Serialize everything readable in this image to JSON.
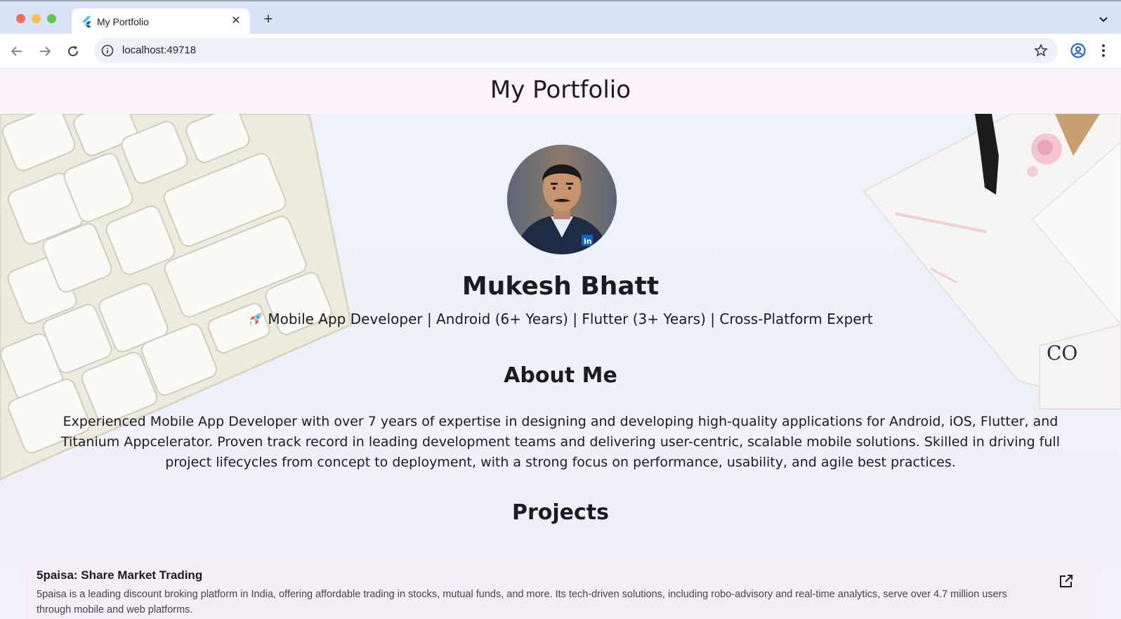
{
  "browser": {
    "tab_title": "My Portfolio",
    "tab_icon": "flutter-icon",
    "url": "localhost:49718",
    "close_icon": "close-icon",
    "new_tab_icon": "plus-icon"
  },
  "appbar": {
    "title": "My Portfolio"
  },
  "profile": {
    "name": "Mukesh Bhatt",
    "tagline": "Mobile App Developer | Android (6+ Years) | Flutter (3+ Years) | Cross-Platform Expert",
    "tagline_icon": "rocket-icon"
  },
  "about": {
    "title": "About Me",
    "text": "Experienced Mobile App Developer with over 7 years of expertise in designing and developing high-quality applications for Android, iOS, Flutter, and Titanium Appcelerator. Proven track record in leading development teams and delivering user-centric, scalable mobile solutions. Skilled in driving full project lifecycles from concept to deployment, with a strong focus on performance, usability, and agile best practices."
  },
  "projects": {
    "title": "Projects",
    "items": [
      {
        "title": "5paisa: Share Market Trading",
        "description": "5paisa is a leading discount broking platform in India, offering affordable trading in stocks, mutual funds, and more. Its tech-driven solutions, including robo-advisory and real-time analytics, serve over 4.7 million users through mobile and web platforms."
      }
    ]
  },
  "colors": {
    "appbar_bg": "#fdf3fa",
    "card_bg": "#f6eef6",
    "text": "#1c1b1f"
  }
}
